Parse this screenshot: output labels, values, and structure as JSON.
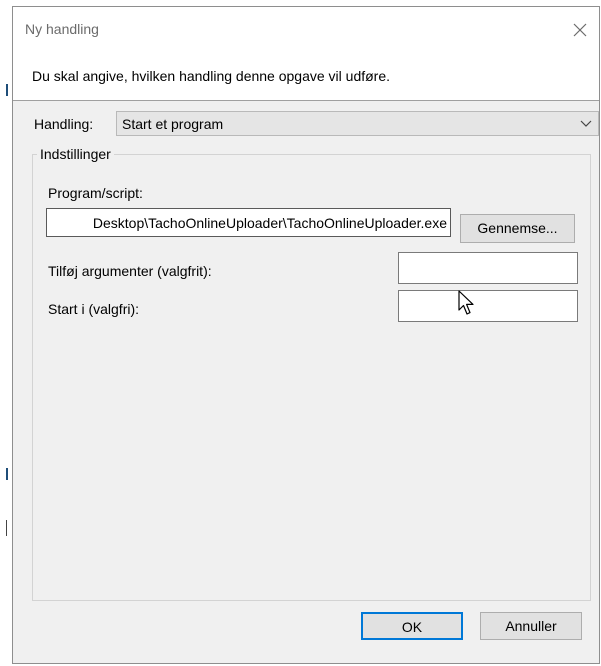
{
  "dialog": {
    "title": "Ny handling",
    "description": "Du skal angive, hvilken handling denne opgave vil udføre.",
    "action_label": "Handling:",
    "action_value": "Start et program",
    "settings_group_label": "Indstillinger",
    "program_label": "Program/script:",
    "program_value": "Desktop\\TachoOnlineUploader\\TachoOnlineUploader.exe",
    "browse_button": "Gennemse...",
    "arguments_label": "Tilføj argumenter (valgfrit):",
    "arguments_value": "",
    "start_in_label": "Start i (valgfri):",
    "start_in_value": "",
    "ok_button": "OK",
    "cancel_button": "Annuller"
  },
  "icons": {
    "close": "close-icon",
    "dropdown": "chevron-down-icon",
    "cursor": "mouse-pointer-icon"
  },
  "colors": {
    "dialog_bg": "#f0f0f0",
    "default_button_border": "#0078d7",
    "button_bg": "#e1e1e1"
  }
}
